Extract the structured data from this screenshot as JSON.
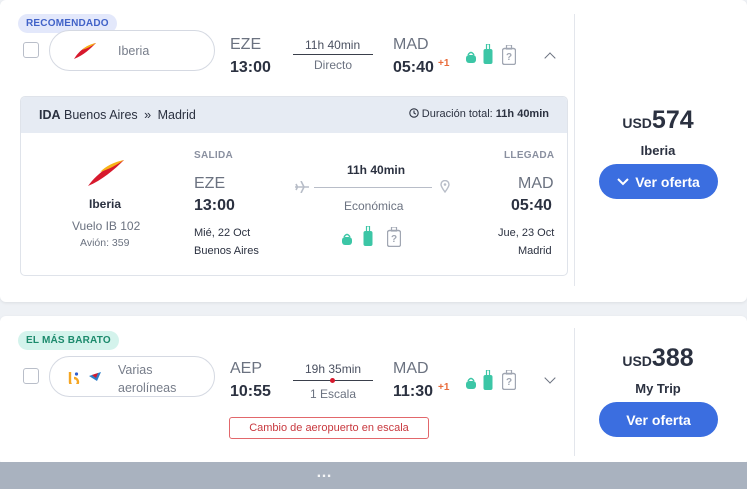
{
  "results": [
    {
      "badge": "RECOMENDADO",
      "airline_name": "Iberia",
      "from_code": "EZE",
      "from_time": "13:00",
      "duration": "11h 40min",
      "stops": "Directo",
      "to_code": "MAD",
      "to_time": "05:40",
      "day_offset": "+1",
      "currency": "USD",
      "price": "574",
      "seller": "Iberia",
      "cta": "Ver oferta",
      "expanded": true,
      "detail": {
        "direction": "IDA",
        "origin_city": "Buenos Aires",
        "sep": "»",
        "dest_city": "Madrid",
        "total_label": "Duración total:",
        "total_value": "11h 40min",
        "airline": "Iberia",
        "flight": "Vuelo IB 102",
        "plane": "Avión: 359",
        "depart_label": "SALIDA",
        "arrive_label": "LLEGADA",
        "from_code": "EZE",
        "from_time": "13:00",
        "from_date": "Mié, 22 Oct",
        "from_city": "Buenos Aires",
        "duration": "11h 40min",
        "cabin": "Económica",
        "to_code": "MAD",
        "to_time": "05:40",
        "to_date": "Jue, 23 Oct",
        "to_city": "Madrid"
      }
    },
    {
      "badge": "EL MÁS BARATO",
      "airline_name": "Varias aerolíneas",
      "from_code": "AEP",
      "from_time": "10:55",
      "duration": "19h 35min",
      "stops": "1 Escala",
      "to_code": "MAD",
      "to_time": "11:30",
      "day_offset": "+1",
      "currency": "USD",
      "price": "388",
      "seller": "My Trip",
      "cta": "Ver oferta",
      "expanded": false,
      "warning": "Cambio de aeropuerto en escala"
    }
  ],
  "colors": {
    "accent": "#3b6ee0",
    "iberia_red": "#d7192d",
    "iberia_yellow": "#f7b318",
    "bag_teal": "#3cc6a6",
    "warning": "#c8393f",
    "plus": "#e86b3a"
  },
  "icons": {
    "personal_item": "personal-item-bag-icon",
    "carry_on": "carry-on-bag-icon",
    "checked": "checked-bag-unknown-icon"
  },
  "bottom_partial_text": "…"
}
